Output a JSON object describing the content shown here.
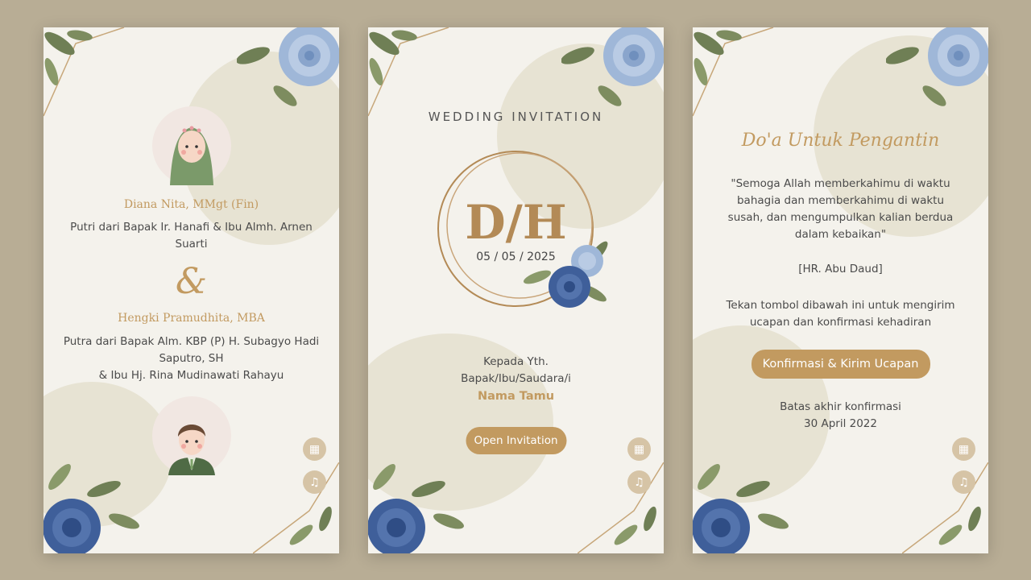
{
  "card1": {
    "bride_name": "Diana Nita, MMgt (Fin)",
    "bride_parents": "Putri dari Bapak Ir. Hanafi & Ibu Almh. Arnen Suarti",
    "ampersand": "&",
    "groom_name": "Hengki Pramudhita, MBA",
    "groom_parents_line1": "Putra dari Bapak Alm. KBP (P) H. Subagyo Hadi Saputro, SH",
    "groom_parents_line2": "& Ibu Hj. Rina Mudinawati Rahayu"
  },
  "card2": {
    "heading": "WEDDING INVITATION",
    "monogram": "D/H",
    "date": "05 / 05 / 2025",
    "to_label": "Kepada Yth.",
    "to_salutation": "Bapak/Ibu/Saudara/i",
    "guest_name": "Nama Tamu",
    "open_button": "Open Invitation"
  },
  "card3": {
    "title": "Do'a Untuk Pengantin",
    "prayer": "\"Semoga Allah memberkahimu di waktu bahagia dan memberkahimu di waktu susah, dan mengumpulkan kalian berdua dalam kebaikan\"",
    "source": "[HR. Abu Daud]",
    "instruction": "Tekan tombol dibawah ini untuk mengirim ucapan dan konfirmasi kehadiran",
    "confirm_button": "Konfirmasi & Kirim Ucapan",
    "deadline_label": "Batas akhir konfirmasi",
    "deadline_date": "30 April 2022"
  },
  "icons": {
    "qr": "qr-code-icon",
    "music": "music-note-icon"
  },
  "colors": {
    "background": "#b8ad95",
    "card": "#f4f2ec",
    "gold": "#c29a60",
    "rose_blue": "#3f5f9a",
    "rose_light": "#9fb7d8",
    "leaf": "#6f7f55"
  }
}
